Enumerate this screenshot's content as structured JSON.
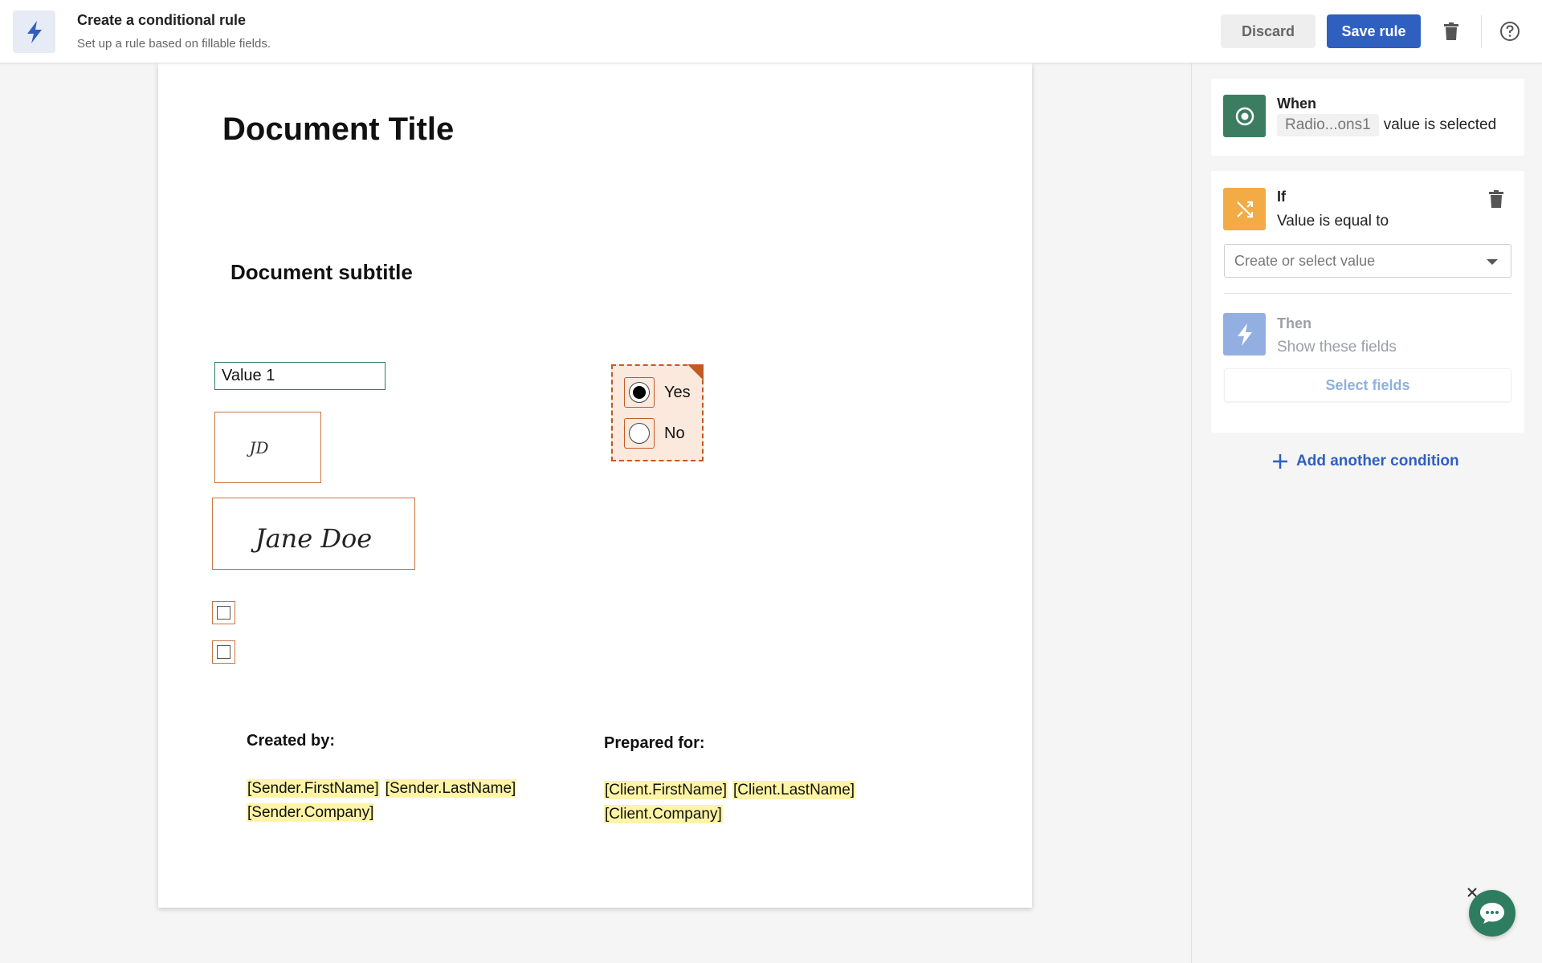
{
  "header": {
    "title": "Create a conditional rule",
    "subtitle": "Set up a rule based on fillable fields.",
    "discard_label": "Discard",
    "save_label": "Save rule",
    "icon": "lightning-icon"
  },
  "document": {
    "title": "Document Title",
    "subtitle": "Document subtitle",
    "text_field_value": "Value 1",
    "initials": "JD",
    "signature": "Jane Doe",
    "radio_options": [
      {
        "label": "Yes",
        "selected": true
      },
      {
        "label": "No",
        "selected": false
      }
    ],
    "created_by_label": "Created by:",
    "prepared_for_label": "Prepared for:",
    "sender_tokens": [
      "[Sender.FirstName]",
      "[Sender.LastName]",
      "[Sender.Company]"
    ],
    "client_tokens": [
      "[Client.FirstName]",
      "[Client.LastName]",
      "[Client.Company]"
    ]
  },
  "panel": {
    "when": {
      "title": "When",
      "field_name": "Radio...ons1",
      "condition_text": "value is selected",
      "color": "#3c7d62"
    },
    "if": {
      "title": "If",
      "condition_text": "Value is equal to",
      "select_placeholder": "Create or select value",
      "color": "#f2ab45"
    },
    "then": {
      "title": "Then",
      "action_text": "Show these fields",
      "select_fields_label": "Select fields",
      "color": "#93aee0"
    },
    "add_condition_label": "Add another condition"
  },
  "colors": {
    "primary": "#2f5fbf",
    "field_border": "#c9753f",
    "token_highlight": "#fdf4a5",
    "chat": "#2e7d60"
  }
}
